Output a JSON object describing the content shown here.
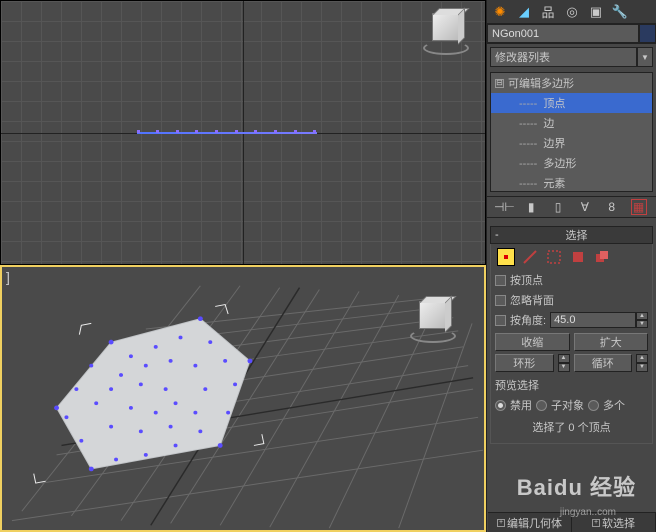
{
  "object_name": "NGon001",
  "modifier_list_label": "修改器列表",
  "stack": {
    "header": "可编辑多边形",
    "items": [
      "顶点",
      "边",
      "边界",
      "多边形",
      "元素"
    ],
    "selected_index": 0
  },
  "rollouts": {
    "selection": {
      "title": "选择",
      "by_vertex": "按顶点",
      "ignore_backfacing": "忽略背面",
      "by_angle": "按角度:",
      "angle_value": "45.0",
      "shrink": "收缩",
      "grow": "扩大",
      "ring": "环形",
      "loop": "循环",
      "preview_label": "预览选择",
      "disable": "禁用",
      "subobj": "子对象",
      "multi": "多个",
      "status": "选择了 0 个顶点"
    }
  },
  "bottom_tabs": {
    "geom": "编辑几何体",
    "soft": "软选择"
  },
  "viewport": {
    "bracket": "]"
  },
  "watermark": {
    "brand": "Baidu 经验",
    "url": "jingyan..com"
  }
}
